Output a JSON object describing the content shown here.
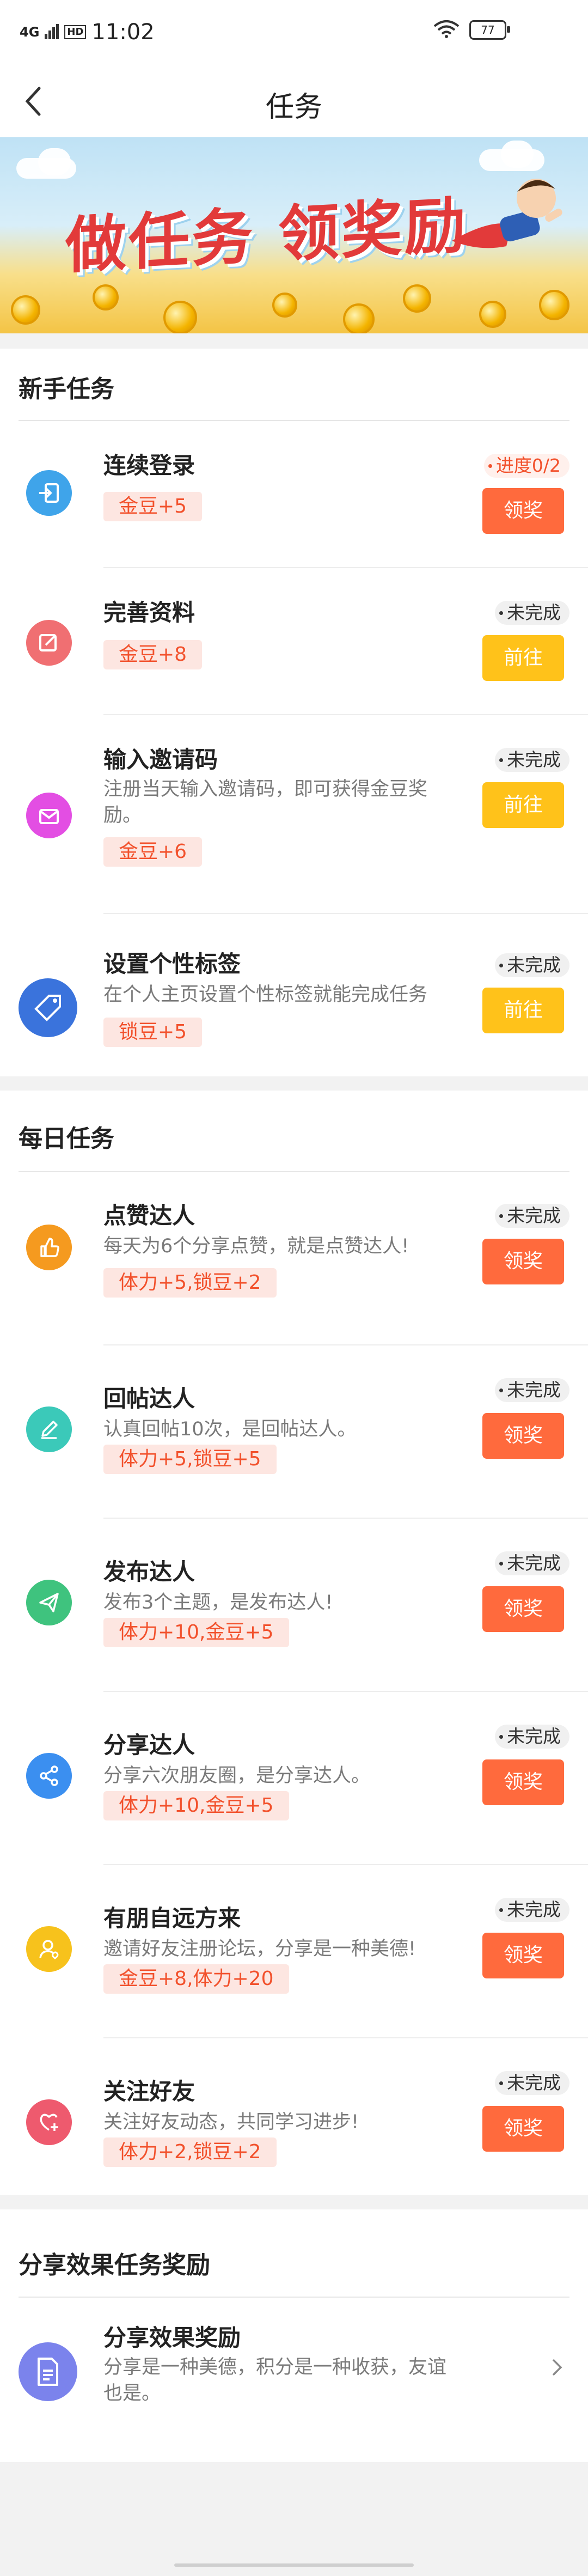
{
  "statusbar": {
    "time": "11:02",
    "battery": "77",
    "signal": "4G",
    "hd": "HD"
  },
  "nav": {
    "title": "任务"
  },
  "banner": {
    "title": "做任务 领奖励"
  },
  "newbie": {
    "title": "新手任务",
    "items": [
      {
        "title": "连续登录",
        "desc": "",
        "reward": "金豆+5",
        "status": "进度0/2",
        "button": "领奖",
        "icon": "login-icon"
      },
      {
        "title": "完善资料",
        "desc": "",
        "reward": "金豆+8",
        "status": "未完成",
        "button": "前往",
        "icon": "edit-icon"
      },
      {
        "title": "输入邀请码",
        "desc": "注册当天输入邀请码，即可获得金豆奖励。",
        "reward": "金豆+6",
        "status": "未完成",
        "button": "前往",
        "icon": "mail-icon"
      },
      {
        "title": "设置个性标签",
        "desc": "在个人主页设置个性标签就能完成任务",
        "reward": "锁豆+5",
        "status": "未完成",
        "button": "前往",
        "icon": "tag-icon"
      }
    ]
  },
  "daily": {
    "title": "每日任务",
    "items": [
      {
        "title": "点赞达人",
        "desc": "每天为6个分享点赞，就是点赞达人!",
        "reward": "体力+5,锁豆+2",
        "status": "未完成",
        "button": "领奖",
        "icon": "thumbs-up-icon"
      },
      {
        "title": "回帖达人",
        "desc": "认真回帖10次，是回帖达人。",
        "reward": "体力+5,锁豆+5",
        "status": "未完成",
        "button": "领奖",
        "icon": "pencil-icon"
      },
      {
        "title": "发布达人",
        "desc": "发布3个主题，是发布达人!",
        "reward": "体力+10,金豆+5",
        "status": "未完成",
        "button": "领奖",
        "icon": "send-icon"
      },
      {
        "title": "分享达人",
        "desc": "分享六次朋友圈，是分享达人。",
        "reward": "体力+10,金豆+5",
        "status": "未完成",
        "button": "领奖",
        "icon": "share-icon"
      },
      {
        "title": "有朋自远方来",
        "desc": "邀请好友注册论坛，分享是一种美德!",
        "reward": "金豆+8,体力+20",
        "status": "未完成",
        "button": "领奖",
        "icon": "invite-user-icon"
      },
      {
        "title": "关注好友",
        "desc": "关注好友动态，共同学习进步!",
        "reward": "体力+2,锁豆+2",
        "status": "未完成",
        "button": "领奖",
        "icon": "heart-plus-icon"
      }
    ]
  },
  "share": {
    "title": "分享效果任务奖励",
    "item": {
      "title": "分享效果奖励",
      "desc": "分享是一种美德，积分是一种收获，友谊也是。",
      "icon": "document-icon"
    }
  },
  "colors": {
    "orange": "#ff6a3d",
    "yellow": "#ffc21a",
    "reward_text": "#f2512c",
    "reward_bg": "#fde6e1"
  }
}
